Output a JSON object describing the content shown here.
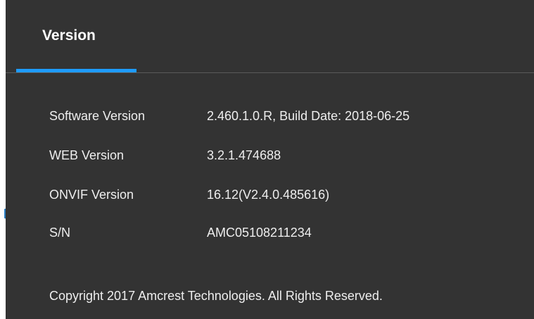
{
  "header": {
    "tab_title": "Version"
  },
  "version_info": {
    "rows": [
      {
        "label": "Software Version",
        "value": "2.460.1.0.R, Build Date: 2018-06-25"
      },
      {
        "label": "WEB Version",
        "value": "3.2.1.474688"
      },
      {
        "label": "ONVIF Version",
        "value": "16.12(V2.4.0.485616)"
      },
      {
        "label": "S/N",
        "value": "AMC05108211234"
      }
    ]
  },
  "footer": {
    "copyright": "Copyright 2017 Amcrest Technologies. All Rights Reserved."
  },
  "colors": {
    "panel_background": "#333333",
    "accent": "#1e9bff",
    "text": "#eeeeee"
  }
}
